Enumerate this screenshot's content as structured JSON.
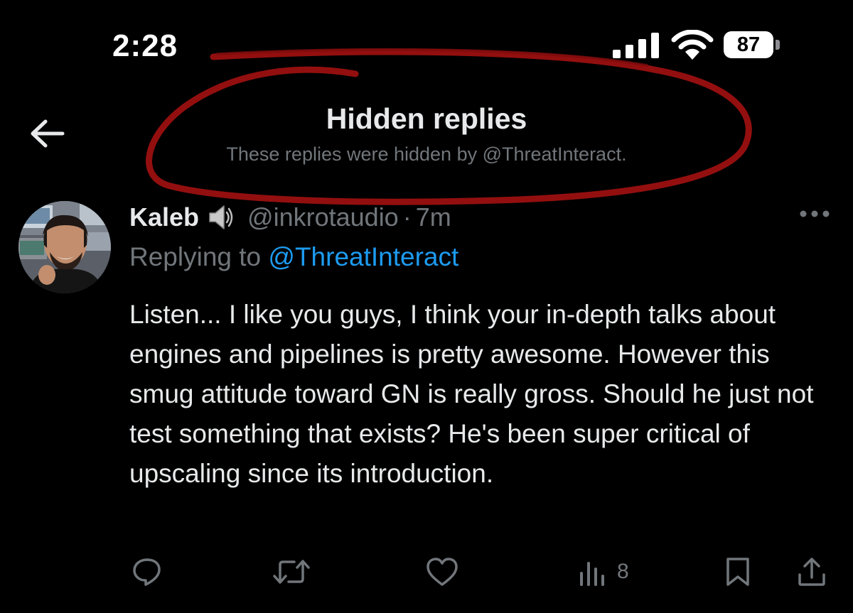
{
  "status_bar": {
    "time": "2:28",
    "battery": "87"
  },
  "header": {
    "title": "Hidden replies",
    "subtitle": "These replies were hidden by @ThreatInteract."
  },
  "tweet": {
    "author_name": "Kaleb",
    "author_handle": "@inkrotaudio",
    "separator": "·",
    "time": "7m",
    "replying_prefix": "Replying to",
    "replying_to": "@ThreatInteract",
    "text": "Listen... I like you guys, I think your in-depth talks about engines and pipelines is pretty awesome. However this smug attitude toward GN is really gross. Should he just not test something that exists? He's been super critical of upscaling since its introduction.",
    "views": "8"
  },
  "colors": {
    "accent": "#1d9bf0",
    "annotation": "#9b1010",
    "muted": "#71767b",
    "background": "#000000"
  },
  "icons": [
    "back-arrow-icon",
    "speaker-icon",
    "more-icon",
    "reply-icon",
    "retweet-icon",
    "like-icon",
    "views-icon",
    "bookmark-icon",
    "share-icon"
  ]
}
